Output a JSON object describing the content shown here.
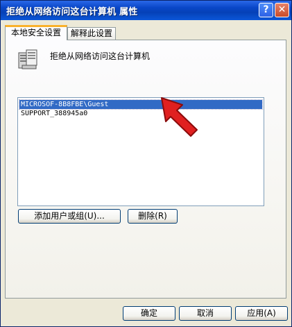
{
  "window": {
    "title": "拒绝从网络访问这台计算机 属性",
    "help_glyph": "?",
    "close_glyph": "✕"
  },
  "tabs": [
    {
      "label": "本地安全设置"
    },
    {
      "label": "解释此设置"
    }
  ],
  "policy": {
    "icon": "server-icon",
    "name": "拒绝从网络访问这台计算机"
  },
  "users": [
    "MICROSOF-8B8FBE\\Guest",
    "SUPPORT_388945a0"
  ],
  "actions": {
    "add_label": "添加用户或组(U)...",
    "remove_label": "删除(R)"
  },
  "footer": {
    "ok_label": "确定",
    "cancel_label": "取消",
    "apply_label": "应用(A)"
  },
  "colors": {
    "title_bar": "#0541b7",
    "selection": "#316ac5",
    "arrow": "#e02020"
  }
}
